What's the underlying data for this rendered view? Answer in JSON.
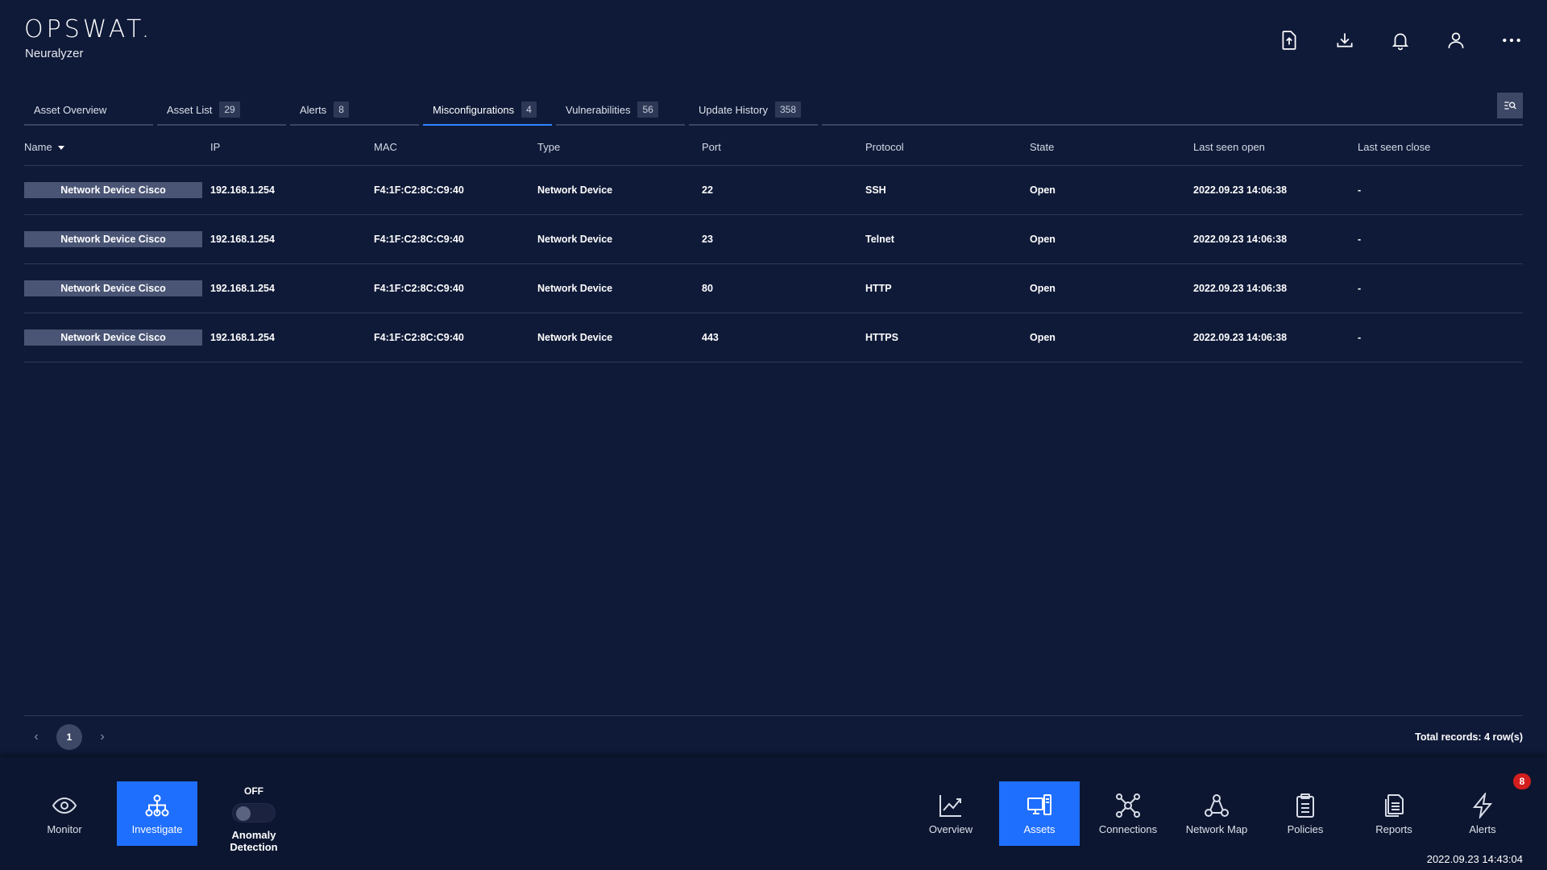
{
  "app": {
    "brand": "OPSWAT.",
    "product": "Neuralyzer"
  },
  "header_actions": [
    {
      "name": "upload-report-button",
      "icon": "file-upload-icon"
    },
    {
      "name": "download-button",
      "icon": "download-icon"
    },
    {
      "name": "notifications-button",
      "icon": "bell-icon"
    },
    {
      "name": "user-button",
      "icon": "user-icon"
    },
    {
      "name": "more-menu-button",
      "icon": "more-horizontal-icon"
    }
  ],
  "tabs": [
    {
      "label": "Asset Overview",
      "count": null,
      "active": false
    },
    {
      "label": "Asset List",
      "count": "29",
      "active": false
    },
    {
      "label": "Alerts",
      "count": "8",
      "active": false
    },
    {
      "label": "Misconfigurations",
      "count": "4",
      "active": true
    },
    {
      "label": "Vulnerabilities",
      "count": "56",
      "active": false
    },
    {
      "label": "Update History",
      "count": "358",
      "active": false
    }
  ],
  "table": {
    "columns": [
      "Name",
      "IP",
      "MAC",
      "Type",
      "Port",
      "Protocol",
      "State",
      "Last seen open",
      "Last seen close"
    ],
    "sort_column": "Name",
    "rows": [
      [
        "Network Device Cisco",
        "192.168.1.254",
        "F4:1F:C2:8C:C9:40",
        "Network Device",
        "22",
        "SSH",
        "Open",
        "2022.09.23 14:06:38",
        "-"
      ],
      [
        "Network Device Cisco",
        "192.168.1.254",
        "F4:1F:C2:8C:C9:40",
        "Network Device",
        "23",
        "Telnet",
        "Open",
        "2022.09.23 14:06:38",
        "-"
      ],
      [
        "Network Device Cisco",
        "192.168.1.254",
        "F4:1F:C2:8C:C9:40",
        "Network Device",
        "80",
        "HTTP",
        "Open",
        "2022.09.23 14:06:38",
        "-"
      ],
      [
        "Network Device Cisco",
        "192.168.1.254",
        "F4:1F:C2:8C:C9:40",
        "Network Device",
        "443",
        "HTTPS",
        "Open",
        "2022.09.23 14:06:38",
        "-"
      ]
    ]
  },
  "pagination": {
    "prev": "‹",
    "current_page": "1",
    "next": "›",
    "total": "Total records: 4 row(s)"
  },
  "bottom_nav": {
    "left": [
      {
        "label": "Monitor",
        "icon": "eye-icon",
        "active": false
      },
      {
        "label": "Investigate",
        "icon": "investigate-icon",
        "active": true
      }
    ],
    "anomaly": {
      "state": "OFF",
      "label": "Anomaly Detection"
    },
    "right": [
      {
        "label": "Overview",
        "icon": "chart-line-icon",
        "active": false
      },
      {
        "label": "Assets",
        "icon": "assets-icon",
        "active": true
      },
      {
        "label": "Connections",
        "icon": "connections-icon",
        "active": false
      },
      {
        "label": "Network Map",
        "icon": "network-map-icon",
        "active": false
      },
      {
        "label": "Policies",
        "icon": "clipboard-icon",
        "active": false
      },
      {
        "label": "Reports",
        "icon": "reports-icon",
        "active": false
      },
      {
        "label": "Alerts",
        "icon": "lightning-icon",
        "active": false,
        "badge": "8"
      }
    ],
    "clock": "2022.09.23 14:43:04"
  },
  "colors": {
    "background": "#0f1a38",
    "accent": "#1f6fff",
    "tab_underline": "#2f86ff",
    "badge": "#d41e1e"
  }
}
